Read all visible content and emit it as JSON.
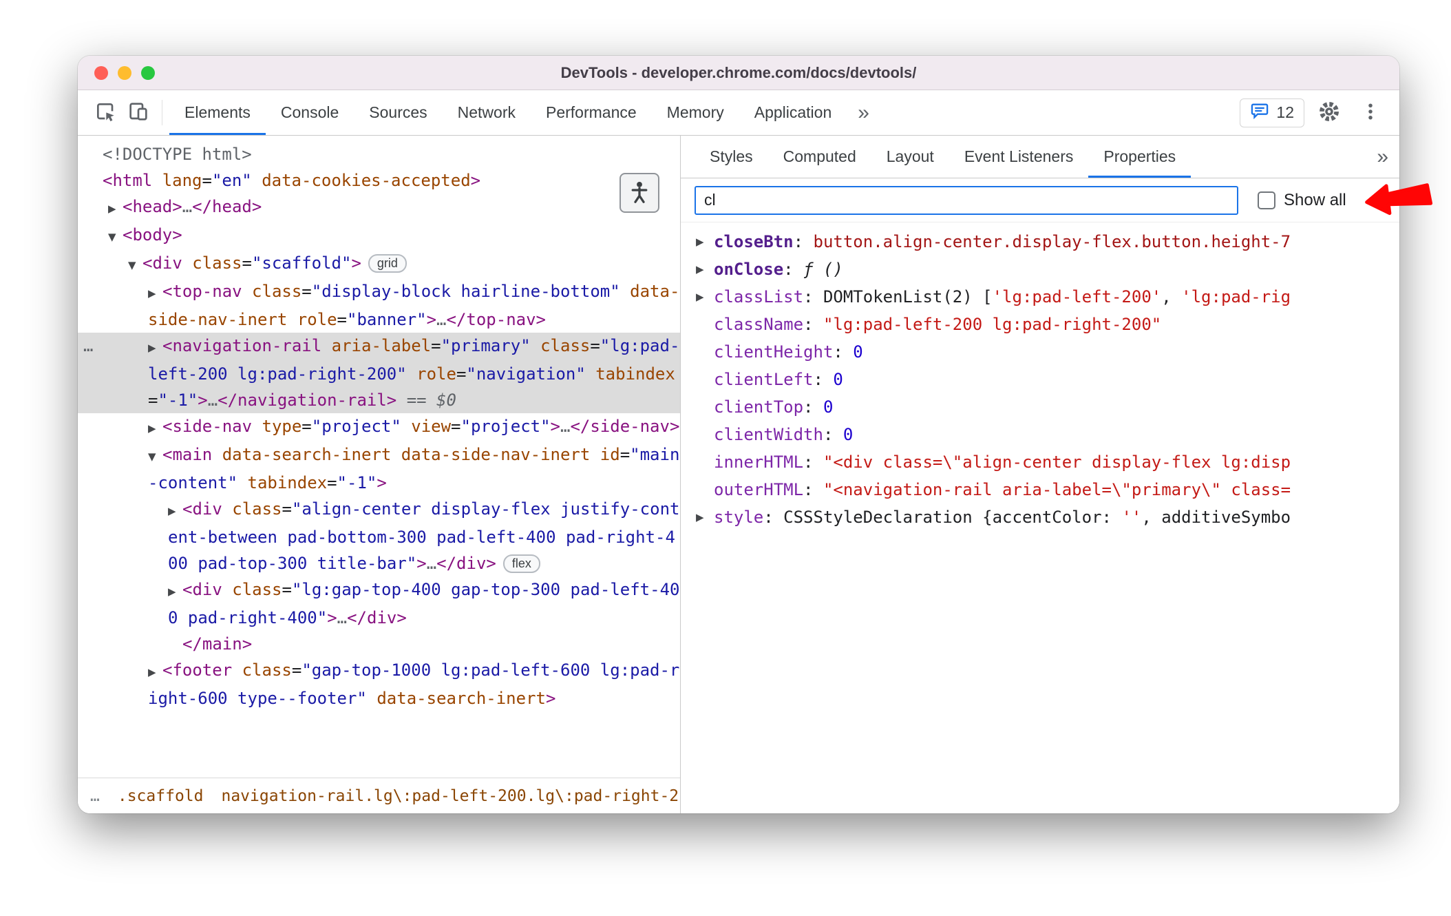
{
  "window": {
    "title": "DevTools - developer.chrome.com/docs/devtools/"
  },
  "colors": {
    "accent": "#1a73e8",
    "annotation_arrow": "#ff0000",
    "selection_background": "#dcdcdc",
    "tag_name": "#881280",
    "attribute_name": "#994500",
    "attribute_value": "#1a1aa6",
    "string_value": "#c41a16",
    "number_value": "#1c00cf"
  },
  "icons": [
    "inspect-cursor-icon",
    "device-toolbar-icon",
    "issues-chat-icon",
    "settings-gear-icon",
    "three-dot-menu-icon",
    "accessibility-person-icon",
    "expand-arrow-icon",
    "collapse-arrow-icon",
    "checkbox-unchecked",
    "red-arrow-annotation"
  ],
  "toolbar": {
    "tabs": [
      {
        "label": "Elements",
        "selected": true
      },
      {
        "label": "Console"
      },
      {
        "label": "Sources"
      },
      {
        "label": "Network"
      },
      {
        "label": "Performance"
      },
      {
        "label": "Memory"
      },
      {
        "label": "Application"
      }
    ],
    "more_symbol": "»",
    "issues_count": "12"
  },
  "elements_panel": {
    "expand_icon": "▶",
    "collapse_icon": "▼",
    "rows": [
      {
        "level": 0,
        "arrow": "",
        "tokens": [
          [
            "<!DOCTYPE html>",
            "dim"
          ]
        ]
      },
      {
        "level": 0,
        "arrow": "",
        "tokens": [
          [
            "<html",
            "tag"
          ],
          [
            " ",
            "plain"
          ],
          [
            "lang",
            "attr"
          ],
          [
            "=",
            "plain"
          ],
          [
            "\"en\"",
            "val"
          ],
          [
            " ",
            "plain"
          ],
          [
            "data-cookies-accepted",
            "attr"
          ],
          [
            ">",
            "tag"
          ]
        ]
      },
      {
        "level": 1,
        "arrow": "▶",
        "tokens": [
          [
            "<head>",
            "tag"
          ],
          [
            "…",
            "dim"
          ],
          [
            "</head>",
            "tag"
          ]
        ]
      },
      {
        "level": 1,
        "arrow": "▼",
        "tokens": [
          [
            "<body>",
            "tag"
          ]
        ]
      },
      {
        "level": 2,
        "arrow": "▼",
        "badge": "grid",
        "tokens": [
          [
            "<div",
            "tag"
          ],
          [
            " ",
            "plain"
          ],
          [
            "class",
            "attr"
          ],
          [
            "=",
            "plain"
          ],
          [
            "\"scaffold\"",
            "val"
          ],
          [
            ">",
            "tag"
          ]
        ]
      },
      {
        "level": 3,
        "arrow": "▶",
        "tokens": [
          [
            "<top-nav",
            "tag"
          ],
          [
            " ",
            "plain"
          ],
          [
            "class",
            "attr"
          ],
          [
            "=",
            "plain"
          ],
          [
            "\"display-block hairline-bottom\"",
            "val"
          ],
          [
            " ",
            "plain"
          ],
          [
            "data-side-nav-inert",
            "attr"
          ],
          [
            " ",
            "plain"
          ],
          [
            "role",
            "attr"
          ],
          [
            "=",
            "plain"
          ],
          [
            "\"banner\"",
            "val"
          ],
          [
            ">",
            "tag"
          ],
          [
            "…",
            "dim"
          ],
          [
            "</top-nav>",
            "tag"
          ]
        ]
      },
      {
        "level": 3,
        "arrow": "▶",
        "selected": true,
        "gutter": "…",
        "tokens": [
          [
            "<navigation-rail",
            "tag"
          ],
          [
            " ",
            "plain"
          ],
          [
            "aria-label",
            "attr"
          ],
          [
            "=",
            "plain"
          ],
          [
            "\"primary\"",
            "val"
          ],
          [
            " ",
            "plain"
          ],
          [
            "class",
            "attr"
          ],
          [
            "=",
            "plain"
          ],
          [
            "\"lg:pad-left-200 lg:pad-right-200\"",
            "val"
          ],
          [
            " ",
            "plain"
          ],
          [
            "role",
            "attr"
          ],
          [
            "=",
            "plain"
          ],
          [
            "\"navigation\"",
            "val"
          ],
          [
            " ",
            "plain"
          ],
          [
            "tabindex",
            "attr"
          ],
          [
            "=",
            "plain"
          ],
          [
            "\"-1\"",
            "val"
          ],
          [
            ">",
            "tag"
          ],
          [
            "…",
            "dim"
          ],
          [
            "</navigation-rail>",
            "tag"
          ],
          [
            " == $0",
            "flag"
          ]
        ]
      },
      {
        "level": 3,
        "arrow": "▶",
        "tokens": [
          [
            "<side-nav",
            "tag"
          ],
          [
            " ",
            "plain"
          ],
          [
            "type",
            "attr"
          ],
          [
            "=",
            "plain"
          ],
          [
            "\"project\"",
            "val"
          ],
          [
            " ",
            "plain"
          ],
          [
            "view",
            "attr"
          ],
          [
            "=",
            "plain"
          ],
          [
            "\"project\"",
            "val"
          ],
          [
            ">",
            "tag"
          ],
          [
            "…",
            "dim"
          ],
          [
            "</side-nav>",
            "tag"
          ]
        ]
      },
      {
        "level": 3,
        "arrow": "▼",
        "tokens": [
          [
            "<main",
            "tag"
          ],
          [
            " ",
            "plain"
          ],
          [
            "data-search-inert",
            "attr"
          ],
          [
            " ",
            "plain"
          ],
          [
            "data-side-nav-inert",
            "attr"
          ],
          [
            " ",
            "plain"
          ],
          [
            "id",
            "attr"
          ],
          [
            "=",
            "plain"
          ],
          [
            "\"main-content\"",
            "val"
          ],
          [
            " ",
            "plain"
          ],
          [
            "tabindex",
            "attr"
          ],
          [
            "=",
            "plain"
          ],
          [
            "\"-1\"",
            "val"
          ],
          [
            ">",
            "tag"
          ]
        ]
      },
      {
        "level": 4,
        "arrow": "▶",
        "badge": "flex",
        "tokens": [
          [
            "<div",
            "tag"
          ],
          [
            " ",
            "plain"
          ],
          [
            "class",
            "attr"
          ],
          [
            "=",
            "plain"
          ],
          [
            "\"align-center display-flex justify-content-between pad-bottom-300 pad-left-400 pad-right-400 pad-top-300 title-bar\"",
            "val"
          ],
          [
            ">",
            "tag"
          ],
          [
            "…",
            "dim"
          ],
          [
            "</div>",
            "tag"
          ]
        ]
      },
      {
        "level": 4,
        "arrow": "▶",
        "tokens": [
          [
            "<div",
            "tag"
          ],
          [
            " ",
            "plain"
          ],
          [
            "class",
            "attr"
          ],
          [
            "=",
            "plain"
          ],
          [
            "\"lg:gap-top-400 gap-top-300 pad-left-400 pad-right-400\"",
            "val"
          ],
          [
            ">",
            "tag"
          ],
          [
            "…",
            "dim"
          ],
          [
            "</div>",
            "tag"
          ]
        ]
      },
      {
        "level": 4,
        "arrow": "",
        "tokens": [
          [
            "</main>",
            "tag"
          ]
        ]
      },
      {
        "level": 3,
        "arrow": "▶",
        "tokens": [
          [
            "<footer",
            "tag"
          ],
          [
            " ",
            "plain"
          ],
          [
            "class",
            "attr"
          ],
          [
            "=",
            "plain"
          ],
          [
            "\"gap-top-1000 lg:pad-left-600 lg:pad-right-600 type--footer\"",
            "val"
          ],
          [
            " ",
            "plain"
          ],
          [
            "data-search-inert",
            "attr"
          ],
          [
            ">",
            "tag"
          ]
        ]
      }
    ],
    "breadcrumbs": [
      {
        "text": "…",
        "dim": true
      },
      {
        "text": ".scaffold"
      },
      {
        "text": "navigation-rail.lg\\:pad-left-200.lg\\:pad-right-2"
      },
      {
        "text": "…",
        "dim": true
      }
    ]
  },
  "sidebar": {
    "tabs": [
      {
        "label": "Styles"
      },
      {
        "label": "Computed"
      },
      {
        "label": "Layout"
      },
      {
        "label": "Event Listeners"
      },
      {
        "label": "Properties",
        "selected": true
      }
    ],
    "more_symbol": "»",
    "expand_icon": "▶",
    "filter_value": "cl",
    "show_all_label": "Show all",
    "properties": [
      {
        "arrow": true,
        "bold": true,
        "name": "closeBtn",
        "value": [
          [
            "button.align-center.display-flex.button.height-7",
            "node"
          ]
        ]
      },
      {
        "arrow": true,
        "bold": true,
        "name": "onClose",
        "value": [
          [
            "ƒ ()",
            "func"
          ]
        ]
      },
      {
        "arrow": true,
        "name": "classList",
        "value": [
          [
            "DOMTokenList(2) [",
            "dark"
          ],
          [
            "'lg:pad-left-200'",
            "str"
          ],
          [
            ", ",
            "dark"
          ],
          [
            "'lg:pad-rig",
            "str"
          ]
        ]
      },
      {
        "name": "className",
        "value": [
          [
            "\"lg:pad-left-200 lg:pad-right-200\"",
            "str"
          ]
        ]
      },
      {
        "name": "clientHeight",
        "value": [
          [
            "0",
            "num"
          ]
        ]
      },
      {
        "name": "clientLeft",
        "value": [
          [
            "0",
            "num"
          ]
        ]
      },
      {
        "name": "clientTop",
        "value": [
          [
            "0",
            "num"
          ]
        ]
      },
      {
        "name": "clientWidth",
        "value": [
          [
            "0",
            "num"
          ]
        ]
      },
      {
        "name": "innerHTML",
        "value": [
          [
            "\"<div class=\\\"align-center display-flex lg:disp",
            "str"
          ]
        ]
      },
      {
        "name": "outerHTML",
        "value": [
          [
            "\"<navigation-rail aria-label=\\\"primary\\\" class=",
            "str"
          ]
        ]
      },
      {
        "arrow": true,
        "name": "style",
        "value": [
          [
            "CSSStyleDeclaration {accentColor: ",
            "dark"
          ],
          [
            "''",
            "str"
          ],
          [
            ", additiveSymbo",
            "dark"
          ]
        ]
      }
    ]
  }
}
